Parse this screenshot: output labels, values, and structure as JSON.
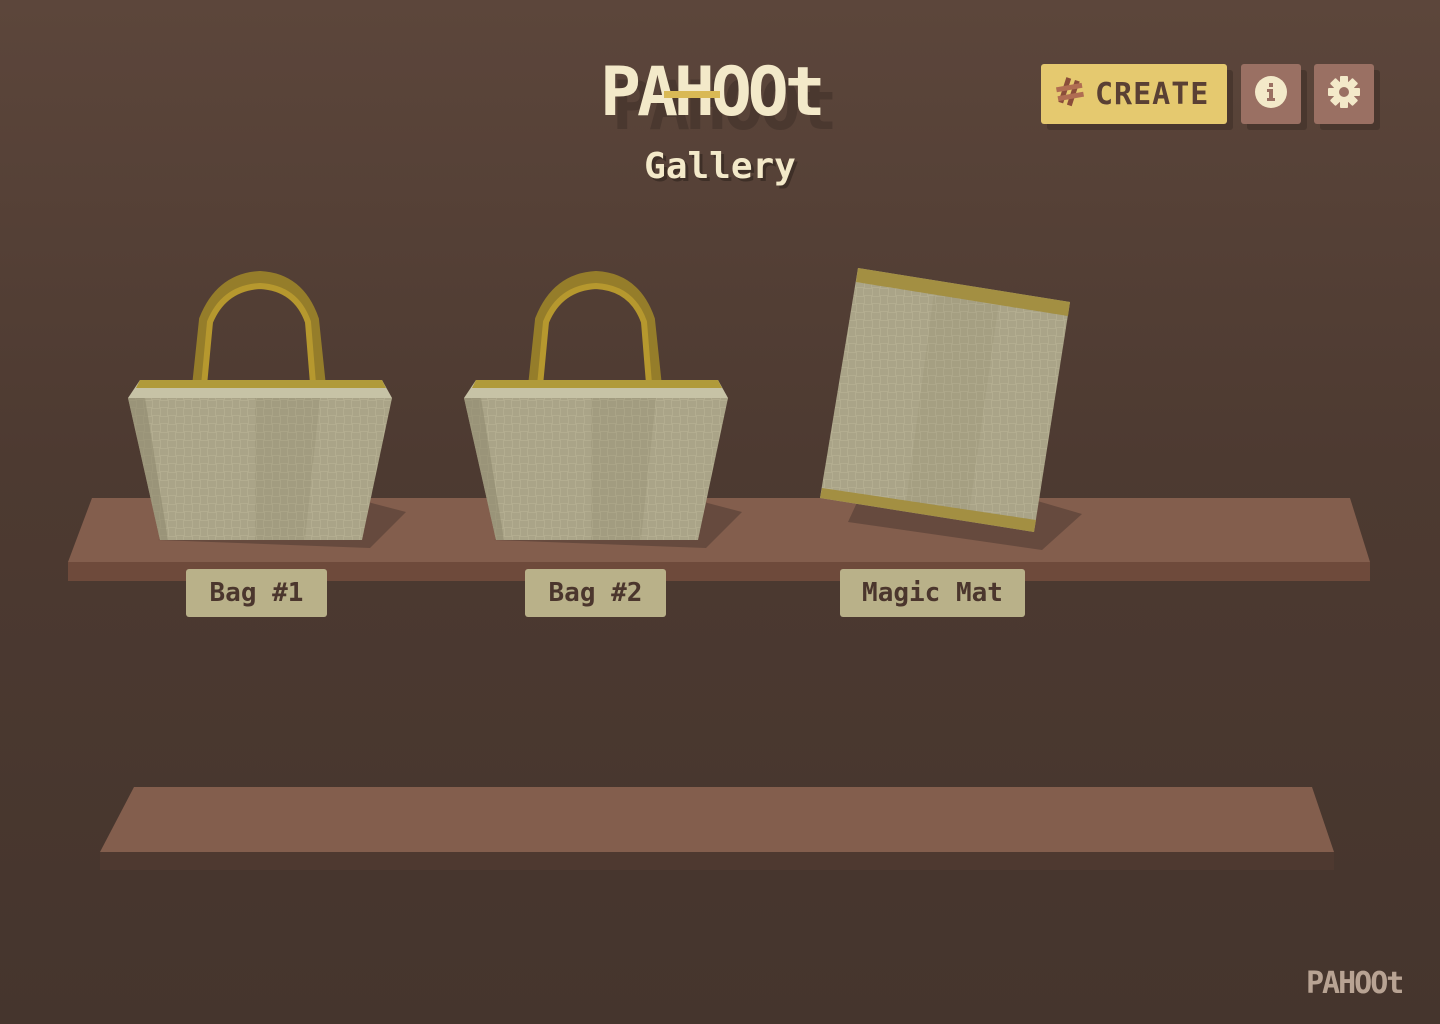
{
  "header": {
    "logo_text": "PAHOOt",
    "subtitle": "Gallery"
  },
  "toolbar": {
    "create_label": "CREATE",
    "create_icon": "weave-icon",
    "info_icon": "info-icon",
    "settings_icon": "gear-icon"
  },
  "gallery": {
    "items": [
      {
        "label": "Bag #1",
        "kind": "bag"
      },
      {
        "label": "Bag #2",
        "kind": "bag"
      },
      {
        "label": "Magic Mat",
        "kind": "mat"
      }
    ]
  },
  "footer": {
    "logo_text": "PAHOOt"
  },
  "colors": {
    "background": "#5c463b",
    "shelf": "#835e4d",
    "shelf_edge": "#6e4a3b",
    "accent": "#e5c96f",
    "label_bg": "#b9b189",
    "logo_text": "#f3e9c9",
    "icon_button": "#9a7063"
  }
}
